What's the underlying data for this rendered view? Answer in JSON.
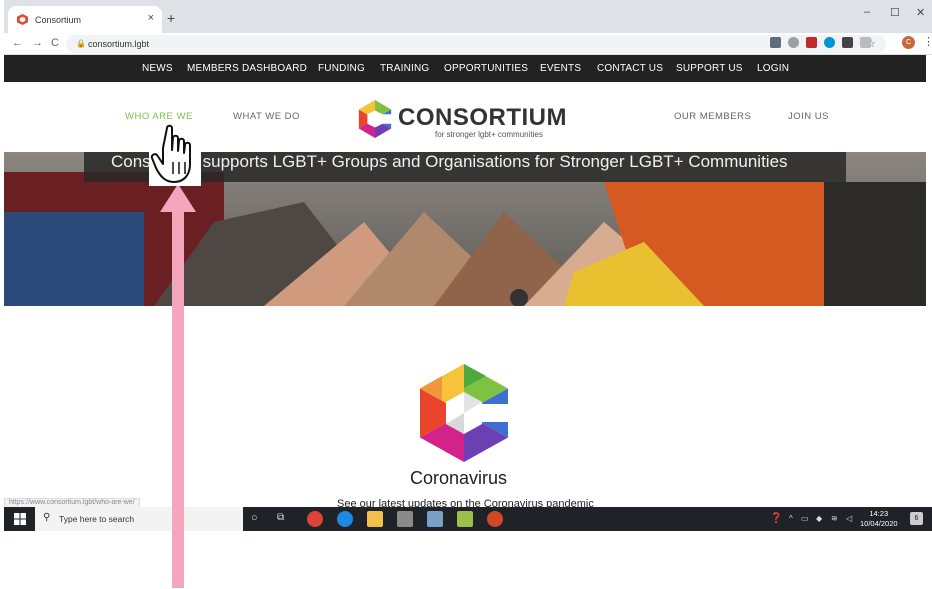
{
  "browser": {
    "tab_title": "Consortium",
    "tab_close": "×",
    "new_tab": "+",
    "url": "consortium.lgbt",
    "window_controls": [
      "–",
      "☐",
      "✕"
    ],
    "nav_icons": [
      "←",
      "→",
      "C"
    ],
    "avatar_initial": "C",
    "status_url": "https://www.consortium.lgbt/who-are-we/"
  },
  "topnav": {
    "items": [
      "NEWS",
      "MEMBERS DASHBOARD",
      "FUNDING",
      "TRAINING",
      "OPPORTUNITIES",
      "EVENTS",
      "CONTACT US",
      "SUPPORT US",
      "LOGIN"
    ]
  },
  "header": {
    "left": [
      "WHO ARE WE",
      "WHAT WE DO"
    ],
    "right": [
      "OUR MEMBERS",
      "JOIN US"
    ],
    "logo_text": "CONSORTIUM",
    "logo_tagline": "for stronger lgbt+ communities",
    "active_color": "#7fc241",
    "nav_color": "#666666"
  },
  "hero": {
    "banner_text": "Consortium supports LGBT+ Groups and Organisations for Stronger LGBT+ Communities"
  },
  "coronavirus": {
    "title": "Coronavirus",
    "subtitle": "See our latest updates on the Coronavirus pandemic"
  },
  "taskbar": {
    "search_placeholder": "Type here to search",
    "time": "14:23",
    "date": "10/04/2020",
    "notification_count": "6"
  },
  "colors": {
    "topnav_bg": "#222222",
    "taskbar_bg": "#1f2328",
    "annotation_arrow": "#f3a6bc"
  }
}
